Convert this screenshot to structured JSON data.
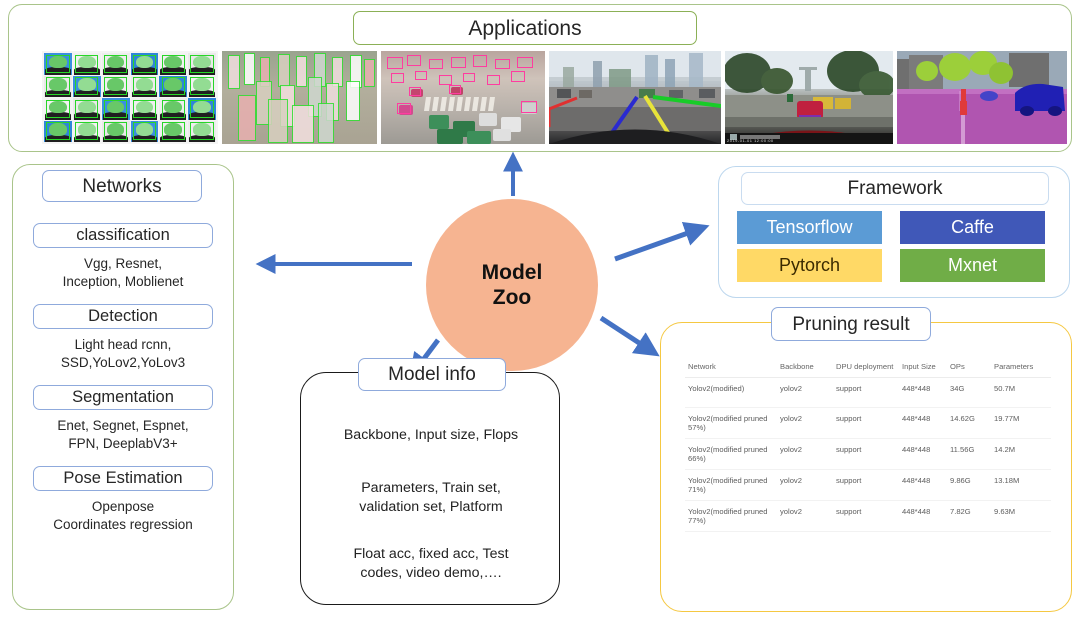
{
  "applications": {
    "title": "Applications",
    "images": [
      {
        "name": "face-recognition-grid",
        "caption": ""
      },
      {
        "name": "pedestrian-detection",
        "caption": ""
      },
      {
        "name": "traffic-intersection-detection",
        "caption": ""
      },
      {
        "name": "lane-detection",
        "caption": ""
      },
      {
        "name": "dashcam-object-detection",
        "caption": "2019-01-01 12:00:00"
      },
      {
        "name": "semantic-segmentation",
        "caption": ""
      }
    ]
  },
  "networks": {
    "title": "Networks",
    "sections": [
      {
        "head": "classification",
        "body": "Vgg, Resnet,\nInception, Moblienet"
      },
      {
        "head": "Detection",
        "body": "Light head rcnn,\nSSD,YoLov2,YoLov3"
      },
      {
        "head": "Segmentation",
        "body": "Enet, Segnet, Espnet,\nFPN, DeeplabV3+"
      },
      {
        "head": "Pose Estimation",
        "body": "Openpose\nCoordinates regression"
      }
    ]
  },
  "model_zoo": {
    "line1": "Model",
    "line2": "Zoo",
    "fill_color": "#F6B491"
  },
  "arrows": {
    "color": "#4472C4",
    "targets": [
      "applications",
      "networks",
      "framework",
      "pruning-result",
      "model-info"
    ]
  },
  "model_info": {
    "title": "Model info",
    "lines": [
      "Backbone, Input size, Flops",
      "Parameters, Train set,\nvalidation set, Platform",
      "Float acc, fixed acc, Test\ncodes, video demo,…."
    ]
  },
  "framework": {
    "title": "Framework",
    "items": [
      {
        "label": "Tensorflow",
        "color": "#5B9BD5",
        "text_color": "#ffffff"
      },
      {
        "label": "Caffe",
        "color": "#4058B8",
        "text_color": "#ffffff"
      },
      {
        "label": "Pytorch",
        "color": "#FFD966",
        "text_color": "#3a2a00"
      },
      {
        "label": "Mxnet",
        "color": "#70AD47",
        "text_color": "#ffffff"
      }
    ]
  },
  "pruning_result": {
    "title": "Pruning result",
    "columns": [
      "Network",
      "Backbone",
      "DPU deployment",
      "Input Size",
      "OPs",
      "Parameters"
    ],
    "rows": [
      {
        "network": "Yolov2(modified)",
        "backbone": "yolov2",
        "dpu": "support",
        "input_size": "448*448",
        "ops": "34G",
        "parameters": "50.7M"
      },
      {
        "network": "Yolov2(modified pruned 57%)",
        "backbone": "yolov2",
        "dpu": "support",
        "input_size": "448*448",
        "ops": "14.62G",
        "parameters": "19.77M"
      },
      {
        "network": "Yolov2(modified pruned 66%)",
        "backbone": "yolov2",
        "dpu": "support",
        "input_size": "448*448",
        "ops": "11.56G",
        "parameters": "14.2M"
      },
      {
        "network": "Yolov2(modified pruned 71%)",
        "backbone": "yolov2",
        "dpu": "support",
        "input_size": "448*448",
        "ops": "9.86G",
        "parameters": "13.18M"
      },
      {
        "network": "Yolov2(modified pruned 77%)",
        "backbone": "yolov2",
        "dpu": "support",
        "input_size": "448*448",
        "ops": "7.82G",
        "parameters": "9.63M"
      }
    ]
  }
}
